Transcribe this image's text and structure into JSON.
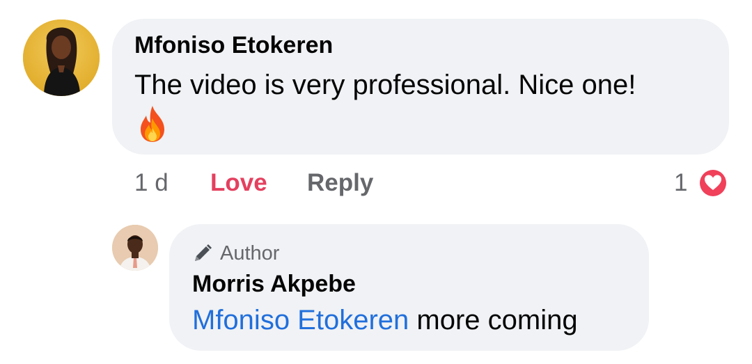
{
  "comment": {
    "author": "Mfoniso Etokeren",
    "text": "The video is very professional. Nice one!",
    "emoji_icon": "fire-icon",
    "time": "1 d",
    "love_label": "Love",
    "reply_label": "Reply",
    "reaction_count": "1",
    "reaction_icon": "heart-icon",
    "colors": {
      "love": "#e4405f",
      "bubble": "#f0f2f5",
      "meta": "#65676b"
    }
  },
  "reply": {
    "badge_icon": "pencil-icon",
    "badge_label": "Author",
    "author": "Morris Akpebe",
    "mention": "Mfoniso Etokeren",
    "text": " more coming",
    "colors": {
      "mention": "#216fdb"
    }
  }
}
